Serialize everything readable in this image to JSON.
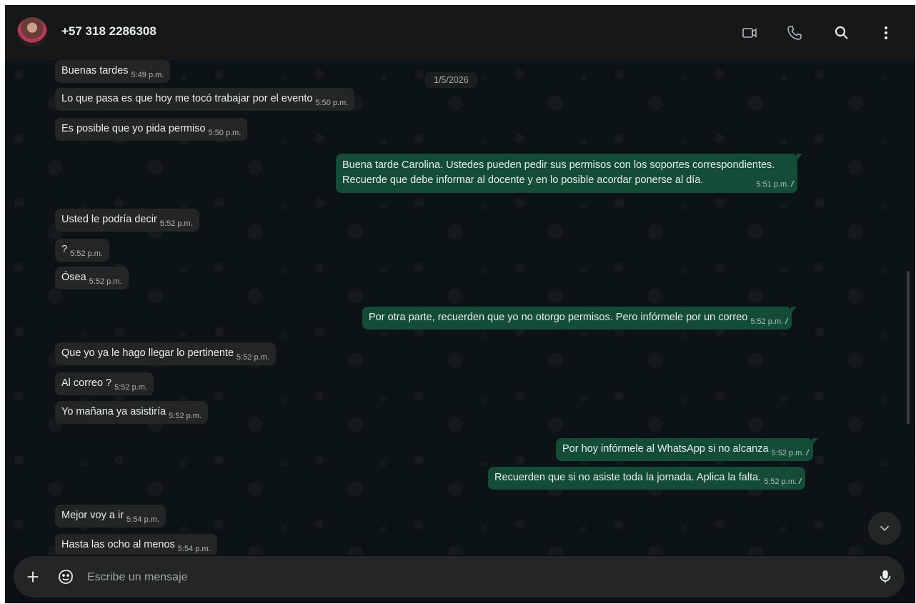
{
  "header": {
    "contact_name": "+57 318 2286308",
    "icons": [
      "video-call-icon",
      "phone-icon",
      "search-icon",
      "menu-icon"
    ]
  },
  "chat": {
    "date_chip": "1/5/2026",
    "messages": [
      {
        "dir": "in",
        "text": "Buenas tardes",
        "time": "5:49 p.m."
      },
      {
        "dir": "in",
        "text": "Lo que pasa es que hoy me tocó trabajar por el evento",
        "time": "5:50 p.m."
      },
      {
        "dir": "in",
        "text": "Es posible que yo pida permiso",
        "time": "5:50 p.m."
      },
      {
        "dir": "out",
        "line1": "Buena tarde Carolina. Ustedes pueden pedir sus permisos con los soportes  correspondientes.",
        "line2": "Recuerde que debe informar al docente y en lo posible acordar ponerse al día.",
        "time": "5:51 p.m.",
        "status": "read"
      },
      {
        "dir": "in",
        "text": "Usted le podría decir",
        "time": "5:52 p.m."
      },
      {
        "dir": "in",
        "text": "?",
        "time": "5:52 p.m."
      },
      {
        "dir": "in",
        "text": "Ósea",
        "time": "5:52 p.m."
      },
      {
        "dir": "out",
        "text": "Por otra parte, recuerden que yo no otorgo permisos. Pero infórmele por un correo",
        "time": "5:52 p.m.",
        "status": "read"
      },
      {
        "dir": "in",
        "text": "Que yo ya le hago llegar lo pertinente",
        "time": "5:52 p.m."
      },
      {
        "dir": "in",
        "text": "Al correo ?",
        "time": "5:52 p.m."
      },
      {
        "dir": "in",
        "text": "Yo mañana ya asistiría",
        "time": "5:52 p.m."
      },
      {
        "dir": "out",
        "text": "Por hoy infórmele al WhatsApp si no alcanza",
        "time": "5:52 p.m.",
        "status": "read"
      },
      {
        "dir": "out",
        "text": "Recuerden que si no asiste toda la jornada. Aplica la falta.",
        "time": "5:52 p.m.",
        "status": "read"
      },
      {
        "dir": "in",
        "text": "Mejor voy a ir",
        "time": "5:54 p.m."
      },
      {
        "dir": "in",
        "text": "Hasta las ocho al menos",
        "time": "5:54 p.m."
      }
    ]
  },
  "composer": {
    "placeholder": "Escribe un mensaje"
  },
  "colors": {
    "incoming_bubble": "#242626",
    "outgoing_bubble": "#144d37",
    "background": "#0c1317"
  }
}
